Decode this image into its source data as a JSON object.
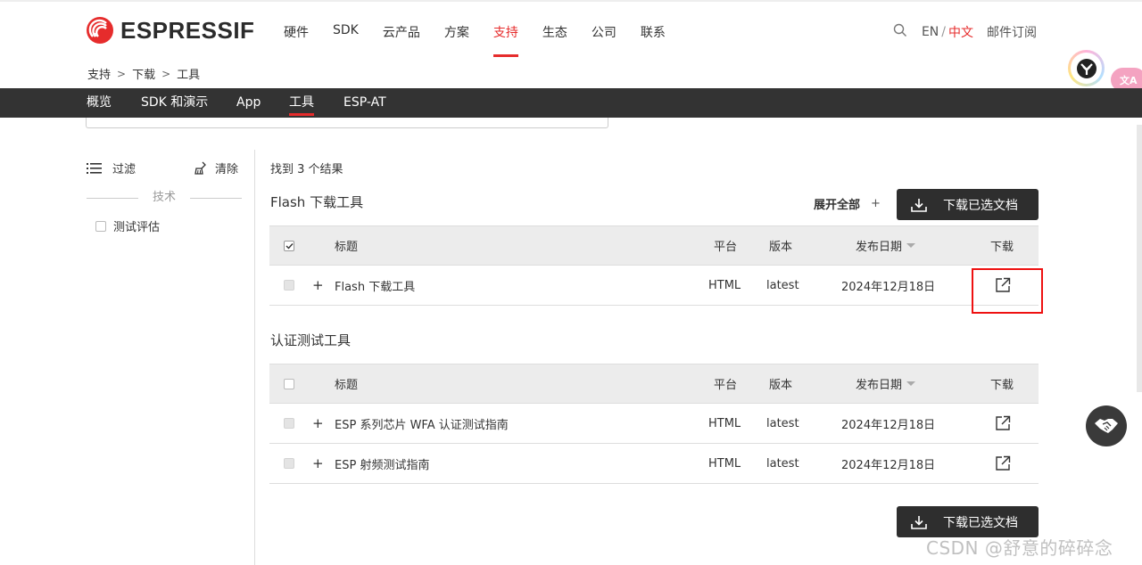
{
  "brand": {
    "name": "ESPRESSIF",
    "accent": "#e62c2c",
    "logo_icon": "espressif-logo-icon"
  },
  "nav": {
    "items": [
      {
        "label": "硬件",
        "active": false
      },
      {
        "label": "SDK",
        "active": false
      },
      {
        "label": "云产品",
        "active": false
      },
      {
        "label": "方案",
        "active": false
      },
      {
        "label": "支持",
        "active": true
      },
      {
        "label": "生态",
        "active": false
      },
      {
        "label": "公司",
        "active": false
      },
      {
        "label": "联系",
        "active": false
      }
    ],
    "lang_en": "EN",
    "lang_sep": "/",
    "lang_zh": "中文",
    "subscribe": "邮件订阅"
  },
  "breadcrumb": [
    "支持",
    "下载",
    "工具"
  ],
  "translate_pill": "文A",
  "subnav": {
    "items": [
      {
        "label": "概览",
        "active": false
      },
      {
        "label": "SDK 和演示",
        "active": false
      },
      {
        "label": "App",
        "active": false
      },
      {
        "label": "工具",
        "active": true
      },
      {
        "label": "ESP-AT",
        "active": false
      }
    ]
  },
  "sidebar": {
    "filter_label": "过滤",
    "clear_label": "清除",
    "tech_heading": "技术",
    "facets": [
      {
        "label": "测试评估"
      }
    ]
  },
  "results": {
    "count_text": "找到 3 个结果",
    "expand_all": "展开全部",
    "expand_plus": "+",
    "download_selected": "下载已选文档",
    "columns": {
      "title": "标题",
      "platform": "平台",
      "version": "版本",
      "date": "发布日期",
      "download": "下载"
    },
    "groups": [
      {
        "title": "Flash 下载工具",
        "rows": [
          {
            "title": "Flash 下载工具",
            "platform": "HTML",
            "version": "latest",
            "date": "2024年12月18日"
          }
        ]
      },
      {
        "title": "认证测试工具",
        "rows": [
          {
            "title": "ESP 系列芯片 WFA 认证测试指南",
            "platform": "HTML",
            "version": "latest",
            "date": "2024年12月18日"
          },
          {
            "title": "ESP 射频测试指南",
            "platform": "HTML",
            "version": "latest",
            "date": "2024年12月18日"
          }
        ]
      }
    ]
  },
  "watermark": "CSDN @舒意的碎碎念"
}
